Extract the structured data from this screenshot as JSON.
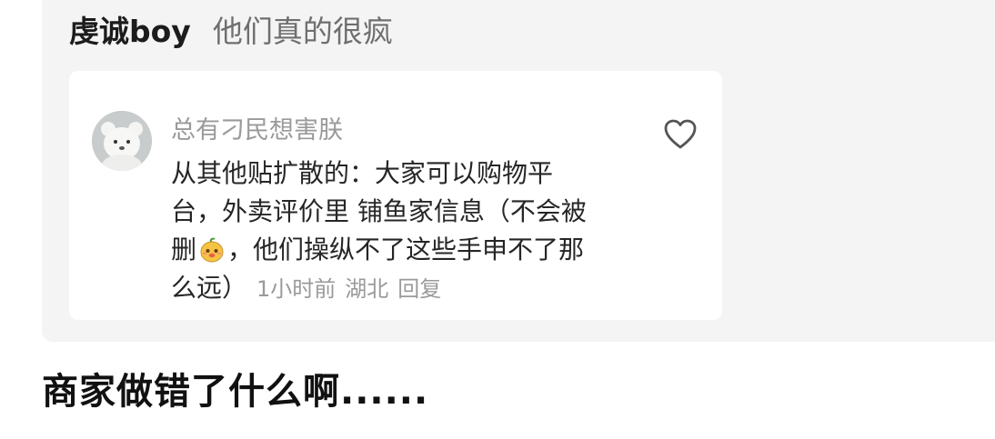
{
  "quoted_post": {
    "header_user": "虔诚boy",
    "header_text": "他们真的很疯"
  },
  "comment": {
    "username": "总有刁民想害朕",
    "avatar_icon": "white-bear-avatar",
    "like_icon": "heart-outline-icon",
    "lines": [
      "从其他贴扩散的：大家可以购物平",
      "台，外卖评价里 铺鱼家信息（不会被",
      "删",
      "，他们操纵不了这些手申不了那",
      "么远）"
    ],
    "emoji_icon": "mango-face-emoji",
    "time": "1小时前",
    "location": "湖北",
    "reply_label": "回复"
  },
  "caption": "商家做错了什么啊......",
  "colors": {
    "panel_bg": "#f4f4f4",
    "card_bg": "#ffffff",
    "muted_text": "#9a9a9a",
    "body_text": "#262626"
  }
}
